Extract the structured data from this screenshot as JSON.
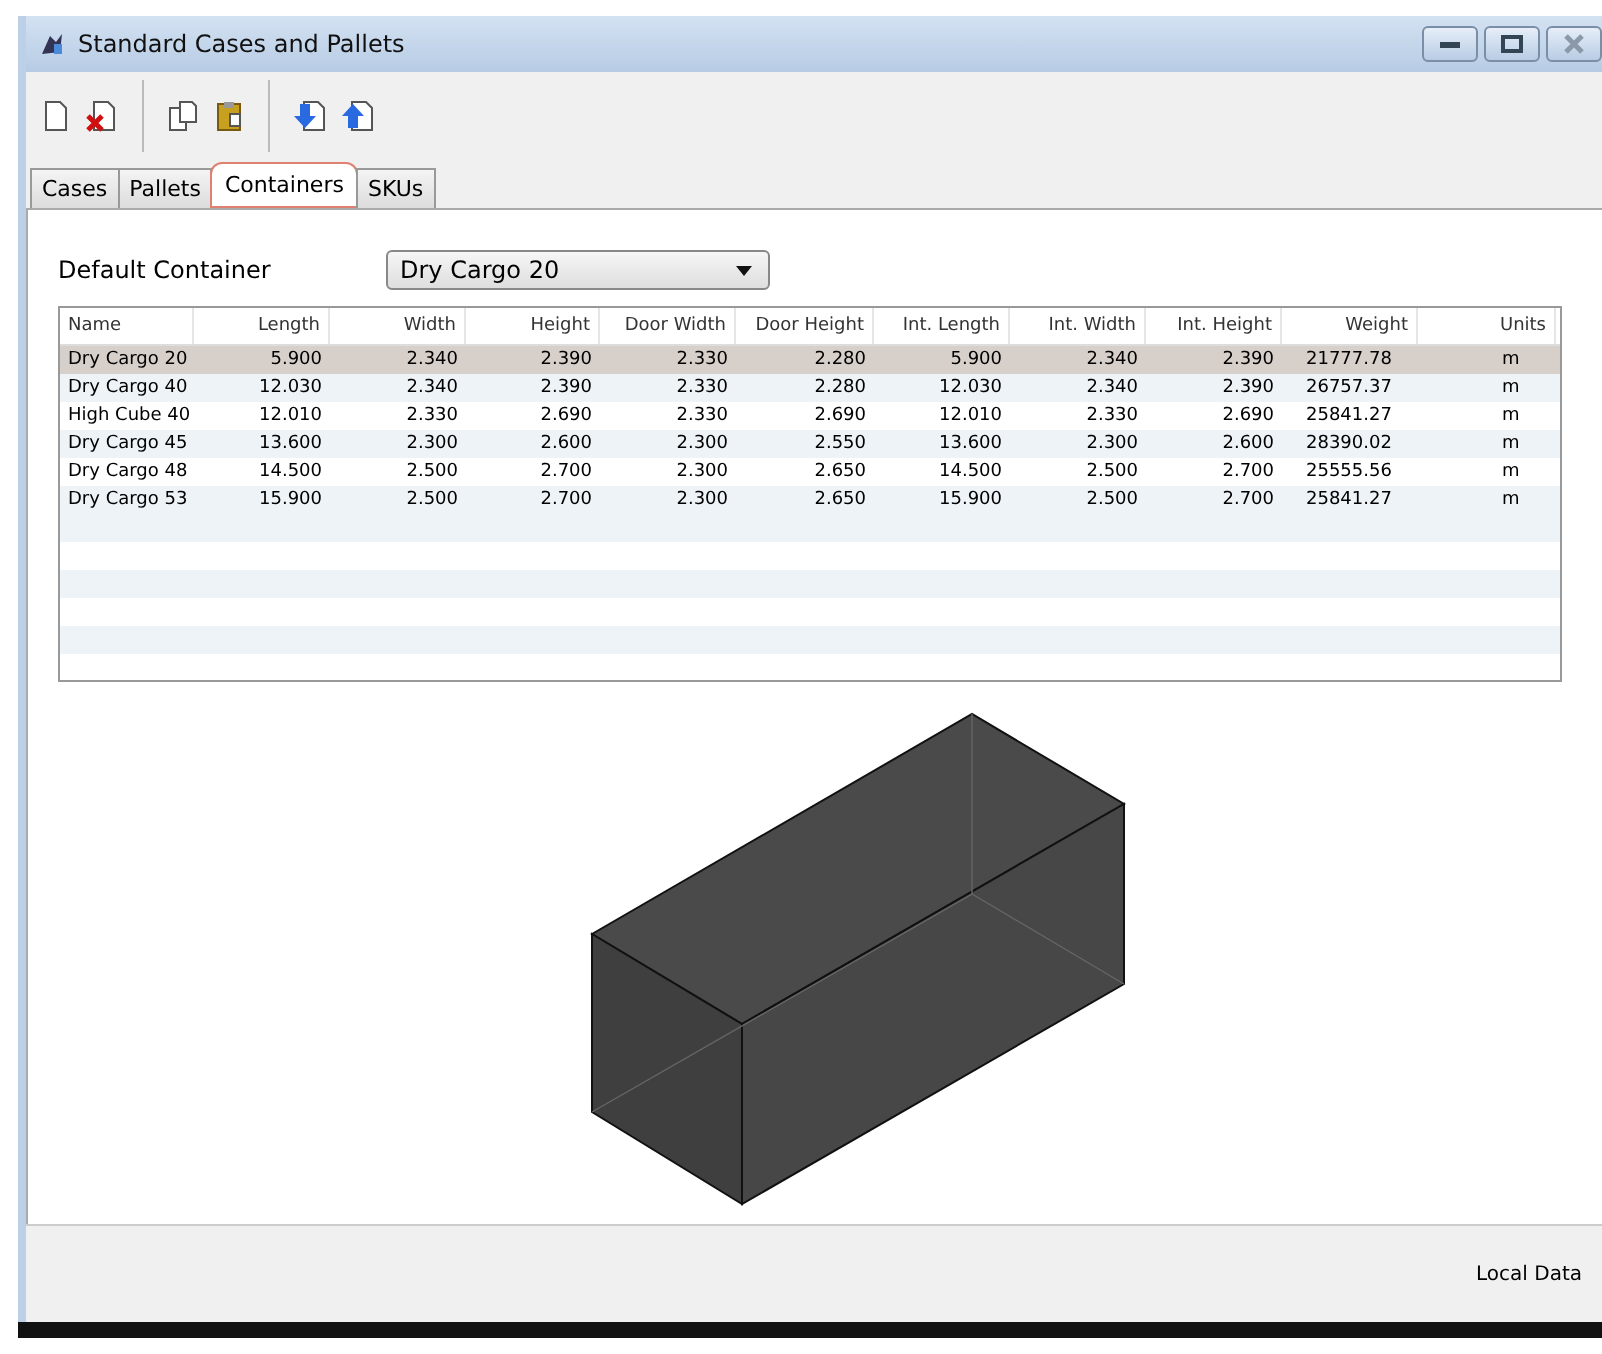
{
  "window": {
    "title": "Standard Cases and Pallets"
  },
  "tabs": [
    {
      "label": "Cases",
      "selected": false
    },
    {
      "label": "Pallets",
      "selected": false
    },
    {
      "label": "Containers",
      "selected": true
    },
    {
      "label": "SKUs",
      "selected": false
    }
  ],
  "default_container": {
    "label": "Default Container",
    "value": "Dry Cargo 20"
  },
  "table": {
    "columns": [
      "Name",
      "Length",
      "Width",
      "Height",
      "Door Width",
      "Door Height",
      "Int. Length",
      "Int. Width",
      "Int. Height",
      "Weight",
      "Units"
    ],
    "rows": [
      {
        "selected": true,
        "cells": [
          "Dry Cargo 20",
          "5.900",
          "2.340",
          "2.390",
          "2.330",
          "2.280",
          "5.900",
          "2.340",
          "2.390",
          "21777.78",
          "m"
        ]
      },
      {
        "selected": false,
        "cells": [
          "Dry Cargo 40",
          "12.030",
          "2.340",
          "2.390",
          "2.330",
          "2.280",
          "12.030",
          "2.340",
          "2.390",
          "26757.37",
          "m"
        ]
      },
      {
        "selected": false,
        "cells": [
          "High Cube 40",
          "12.010",
          "2.330",
          "2.690",
          "2.330",
          "2.690",
          "12.010",
          "2.330",
          "2.690",
          "25841.27",
          "m"
        ]
      },
      {
        "selected": false,
        "cells": [
          "Dry Cargo 45",
          "13.600",
          "2.300",
          "2.600",
          "2.300",
          "2.550",
          "13.600",
          "2.300",
          "2.600",
          "28390.02",
          "m"
        ]
      },
      {
        "selected": false,
        "cells": [
          "Dry Cargo 48",
          "14.500",
          "2.500",
          "2.700",
          "2.300",
          "2.650",
          "14.500",
          "2.500",
          "2.700",
          "25555.56",
          "m"
        ]
      },
      {
        "selected": false,
        "cells": [
          "Dry Cargo 53",
          "15.900",
          "2.500",
          "2.700",
          "2.300",
          "2.650",
          "15.900",
          "2.500",
          "2.700",
          "25841.27",
          "m"
        ]
      }
    ]
  },
  "status_bar": {
    "text": "Local Data"
  }
}
